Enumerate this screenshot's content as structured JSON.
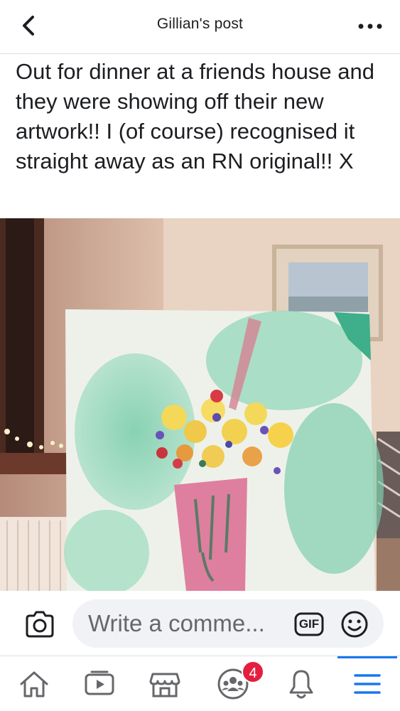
{
  "header": {
    "title": "Gillian's post",
    "back_icon": "chevron-left-icon",
    "more_icon": "more-dots-icon"
  },
  "post": {
    "text": "Out for dinner at a friends house and they were showing off their new artwork!! I (of course) recognised it straight away as an RN original!! X",
    "photo_description_icon": "photo"
  },
  "comment_bar": {
    "placeholder": "Write a comme...",
    "camera_icon": "camera-icon",
    "gif_label": "GIF",
    "emoji_icon": "smiley-icon"
  },
  "bottom_nav": {
    "items": [
      {
        "icon": "home-icon"
      },
      {
        "icon": "watch-icon"
      },
      {
        "icon": "marketplace-icon"
      },
      {
        "icon": "groups-icon",
        "badge": "4"
      },
      {
        "icon": "bell-icon"
      },
      {
        "icon": "menu-icon",
        "active": true
      }
    ],
    "accent_color": "#1877f2",
    "badge_color": "#e41e3f"
  }
}
